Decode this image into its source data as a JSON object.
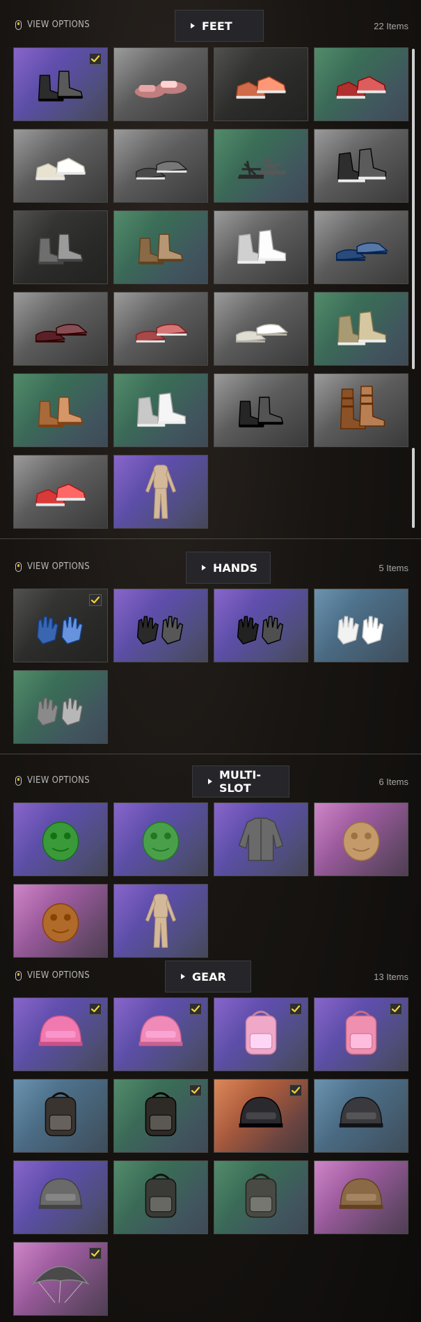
{
  "view_options_label": "VIEW OPTIONS",
  "sections": [
    {
      "id": "feet",
      "title": "FEET",
      "count": "22 Items",
      "items": [
        {
          "name": "black-boots",
          "bg": "purple",
          "kind": "boots",
          "color": "#2c2c2c",
          "checked": true
        },
        {
          "name": "pink-slides",
          "bg": "grey",
          "kind": "slides",
          "color": "#e8a6a6",
          "checked": false
        },
        {
          "name": "orange-sneakers",
          "bg": "dark",
          "kind": "sneakers",
          "color": "#d06a48",
          "checked": false
        },
        {
          "name": "red-black-sneakers",
          "bg": "green",
          "kind": "sneakers",
          "color": "#b03030",
          "checked": false
        },
        {
          "name": "white-navy-sneakers",
          "bg": "grey",
          "kind": "sneakers",
          "color": "#e8e2d0",
          "checked": false
        },
        {
          "name": "grey-slip-ons",
          "bg": "grey",
          "kind": "slipons",
          "color": "#4a4a4a",
          "checked": false
        },
        {
          "name": "black-sandals",
          "bg": "green",
          "kind": "sandals",
          "color": "#2a2a2a",
          "checked": false
        },
        {
          "name": "black-high-tops",
          "bg": "grey",
          "kind": "hightops",
          "color": "#2e2e2e",
          "checked": false
        },
        {
          "name": "grey-worn-boots",
          "bg": "dark",
          "kind": "boots",
          "color": "#6e6e6e",
          "checked": false
        },
        {
          "name": "brown-boots",
          "bg": "green",
          "kind": "boots",
          "color": "#8a6a46",
          "checked": false
        },
        {
          "name": "white-high-tops",
          "bg": "grey",
          "kind": "hightops",
          "color": "#d0d0d0",
          "checked": false
        },
        {
          "name": "blue-loafers",
          "bg": "grey",
          "kind": "loafers",
          "color": "#2a4a7a",
          "checked": false
        },
        {
          "name": "maroon-loafers",
          "bg": "grey",
          "kind": "loafers",
          "color": "#5a2228",
          "checked": false
        },
        {
          "name": "patterned-slip-ons",
          "bg": "grey",
          "kind": "slipons",
          "color": "#a84848",
          "checked": false
        },
        {
          "name": "white-loafers",
          "bg": "grey",
          "kind": "loafers",
          "color": "#e0ddd2",
          "checked": false
        },
        {
          "name": "tan-high-tops",
          "bg": "green",
          "kind": "hightops",
          "color": "#a89a72",
          "checked": false
        },
        {
          "name": "orange-camo-boots",
          "bg": "green",
          "kind": "boots",
          "color": "#a86a3a",
          "checked": false
        },
        {
          "name": "red-white-high-tops",
          "bg": "green",
          "kind": "hightops",
          "color": "#c8c8c8",
          "checked": false
        },
        {
          "name": "black-combat-boots",
          "bg": "grey",
          "kind": "boots",
          "color": "#262626",
          "checked": false
        },
        {
          "name": "brown-buckle-boots",
          "bg": "grey",
          "kind": "tallboots",
          "color": "#8a5226",
          "checked": false
        },
        {
          "name": "red-sneakers",
          "bg": "grey",
          "kind": "sneakers",
          "color": "#d83a3a",
          "checked": false
        },
        {
          "name": "bodysuit",
          "bg": "purple",
          "kind": "bodysuit",
          "color": "#d4b89a",
          "checked": false
        }
      ]
    },
    {
      "id": "hands",
      "title": "HANDS",
      "count": "5 Items",
      "items": [
        {
          "name": "blue-fingerless-gloves",
          "bg": "dark",
          "kind": "gloves",
          "color": "#3a66b0",
          "checked": true
        },
        {
          "name": "black-red-gloves",
          "bg": "purple",
          "kind": "gloves",
          "color": "#2a2a2a",
          "checked": false
        },
        {
          "name": "black-fingerless-gloves",
          "bg": "purple",
          "kind": "gloves",
          "color": "#222222",
          "checked": false
        },
        {
          "name": "white-cartoon-gloves",
          "bg": "blue",
          "kind": "gloves",
          "color": "#f2f2f2",
          "checked": false
        },
        {
          "name": "chainmail-gloves",
          "bg": "green",
          "kind": "gloves",
          "color": "#8a8a8a",
          "checked": false
        }
      ]
    },
    {
      "id": "multi-slot",
      "title": "MULTI-SLOT",
      "count": "6 Items",
      "items": [
        {
          "name": "green-croc-mask",
          "bg": "purple",
          "kind": "mask",
          "color": "#3a9a3a",
          "checked": false
        },
        {
          "name": "dino-mask",
          "bg": "purple",
          "kind": "mask",
          "color": "#4aa04a",
          "checked": false
        },
        {
          "name": "grey-jacket",
          "bg": "purple",
          "kind": "jacket",
          "color": "#6a6a6a",
          "checked": false
        },
        {
          "name": "tan-balaclava",
          "bg": "pink",
          "kind": "mask",
          "color": "#c49a6a",
          "checked": false
        },
        {
          "name": "lion-mask",
          "bg": "pink",
          "kind": "mask",
          "color": "#b06a2a",
          "checked": false
        },
        {
          "name": "bodysuit",
          "bg": "purple",
          "kind": "bodysuit",
          "color": "#d4b89a",
          "checked": false
        }
      ]
    },
    {
      "id": "gear",
      "title": "GEAR",
      "count": "13 Items",
      "items": [
        {
          "name": "pink-winged-helmet",
          "bg": "purple",
          "kind": "helmet",
          "color": "#f07ab0",
          "checked": true
        },
        {
          "name": "pink-creature-helmet",
          "bg": "purple",
          "kind": "helmet",
          "color": "#f08ab8",
          "checked": true
        },
        {
          "name": "pink-backpack",
          "bg": "purple",
          "kind": "backpack",
          "color": "#f0a8c8",
          "checked": true
        },
        {
          "name": "pink-bow-backpack",
          "bg": "purple",
          "kind": "backpack",
          "color": "#f090b0",
          "checked": true
        },
        {
          "name": "camo-backpack",
          "bg": "blue",
          "kind": "backpack",
          "color": "#3a3430",
          "checked": false
        },
        {
          "name": "dark-backpack",
          "bg": "green",
          "kind": "backpack",
          "color": "#2e2a26",
          "checked": true
        },
        {
          "name": "riot-helmet",
          "bg": "orange",
          "kind": "helmet",
          "color": "#2a2a2e",
          "checked": true
        },
        {
          "name": "pilot-helmet",
          "bg": "blue",
          "kind": "helmet",
          "color": "#3a3a3e",
          "checked": false
        },
        {
          "name": "camo-helmet",
          "bg": "purple",
          "kind": "helmet",
          "color": "#6a6a6a",
          "checked": false
        },
        {
          "name": "tactical-backpack",
          "bg": "green",
          "kind": "backpack",
          "color": "#3a3a36",
          "checked": false
        },
        {
          "name": "tactical-backpack-2",
          "bg": "green",
          "kind": "backpack",
          "color": "#4a4a44",
          "checked": false
        },
        {
          "name": "aviator-helmet",
          "bg": "pink",
          "kind": "helmet",
          "color": "#8a6a46",
          "checked": false
        },
        {
          "name": "camo-parachute",
          "bg": "pink",
          "kind": "parachute",
          "color": "#4a4a4a",
          "checked": true
        }
      ]
    }
  ]
}
